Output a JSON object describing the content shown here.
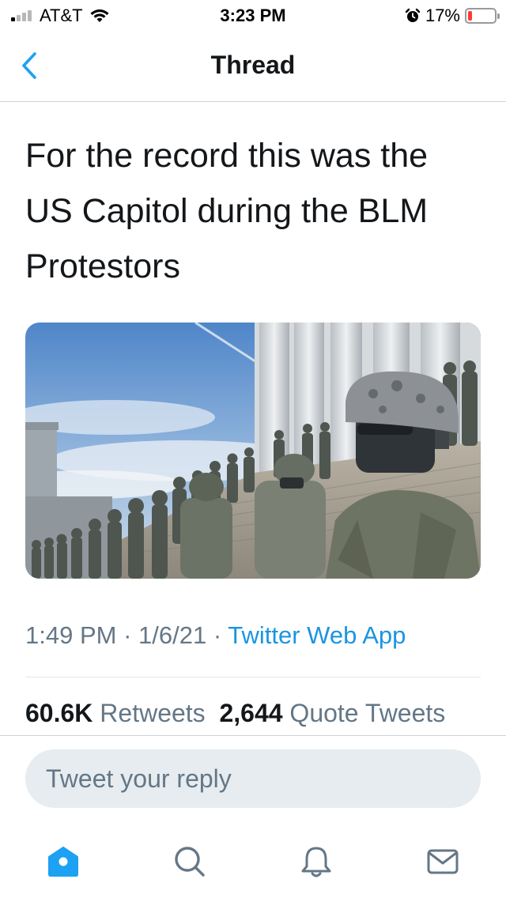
{
  "status_bar": {
    "carrier": "AT&T",
    "time": "3:23 PM",
    "battery_percent": "17%",
    "signal_bars_active": 1,
    "battery_level": 0.17,
    "battery_color": "#ff3b30"
  },
  "nav": {
    "back_icon": "chevron-left-icon",
    "title": "Thread"
  },
  "tweet": {
    "text": "For the record this was the US Capitol during the BLM Protestors",
    "time": "1:49 PM",
    "separator": "·",
    "date": "1/6/21",
    "source": "Twitter Web App",
    "stats": {
      "retweets_count": "60.6K",
      "retweets_label": "Retweets",
      "quotes_count": "2,644",
      "quotes_label": "Quote Tweets"
    }
  },
  "reply": {
    "placeholder": "Tweet your reply"
  },
  "tabbar": {
    "items": [
      {
        "icon": "home-icon",
        "active": true
      },
      {
        "icon": "search-icon",
        "active": false
      },
      {
        "icon": "bell-icon",
        "active": false
      },
      {
        "icon": "mail-icon",
        "active": false
      }
    ]
  },
  "colors": {
    "accent": "#1da1f2",
    "link": "#1b95e0",
    "muted": "#657786",
    "text": "#14171a"
  }
}
